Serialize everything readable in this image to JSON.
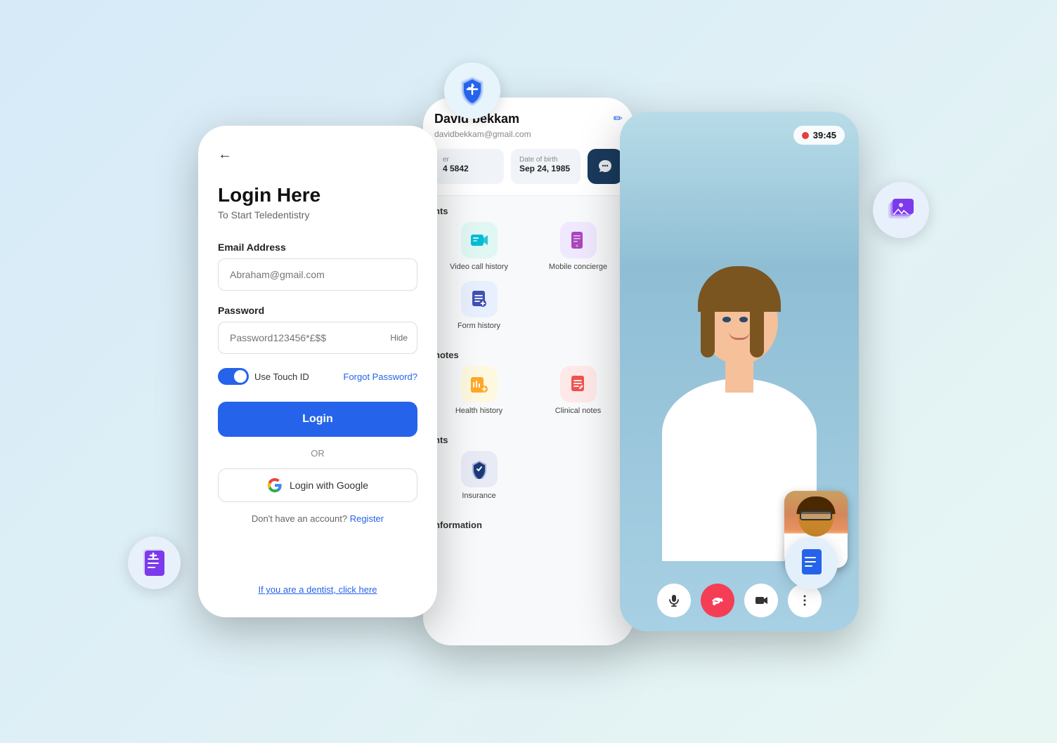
{
  "scene": {
    "background": "#d6eaf8"
  },
  "float_icons": {
    "health_shield": "🛡",
    "photos": "🖼",
    "doc_purple": "📄",
    "doc_blue": "📋"
  },
  "login_phone": {
    "back_arrow": "←",
    "title": "Login Here",
    "subtitle": "To Start Teledentistry",
    "email_label": "Email Address",
    "email_placeholder": "Abraham@gmail.com",
    "password_label": "Password",
    "password_placeholder": "Password123456*£$$",
    "hide_label": "Hide",
    "touch_id_label": "Use Touch ID",
    "forgot_label": "Forgot Password?",
    "login_btn": "Login",
    "or_text": "OR",
    "google_btn": "Login with Google",
    "no_account": "Don't have an account?",
    "register_link": "Register",
    "dentist_link": "If you are a dentist, click here"
  },
  "profile_phone": {
    "name": "David bekkam",
    "email": "davidbekkam@gmail.com",
    "phone_label": "er",
    "phone_value": "4 5842",
    "dob_label": "Date of birth",
    "dob_value": "Sep 24, 1985",
    "section_appointments": "nts",
    "section_notes": "notes",
    "section_information": "nformation",
    "menu_items": [
      {
        "label": "Video call history",
        "icon": "📅",
        "bg": "teal"
      },
      {
        "label": "Mobile concierge",
        "icon": "🏠",
        "bg": "purple"
      },
      {
        "label": "Form history",
        "icon": "📋",
        "bg": "blue"
      },
      {
        "label": "Health history",
        "icon": "📊",
        "bg": "yellow"
      },
      {
        "label": "Clinical notes",
        "icon": "📋",
        "bg": "red"
      },
      {
        "label": "Insurance",
        "icon": "🛡",
        "bg": "navy"
      }
    ]
  },
  "video_phone": {
    "recording_time": "39:45",
    "mic_icon": "mic",
    "end_icon": "phone",
    "cam_icon": "video",
    "more_icon": "more"
  }
}
